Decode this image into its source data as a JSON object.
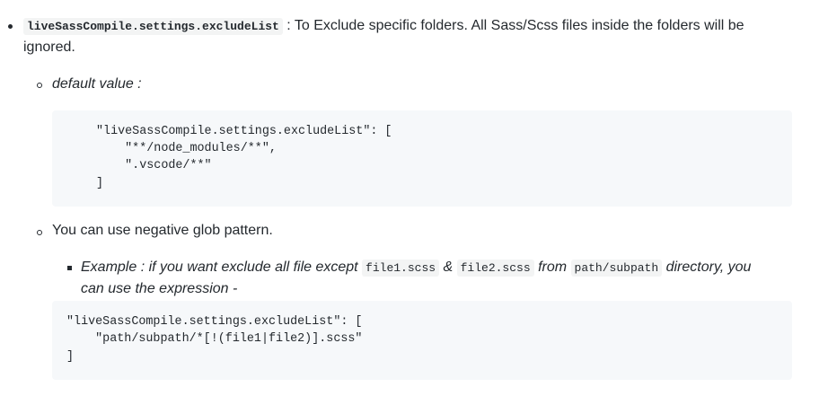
{
  "item1": {
    "setting_key": "liveSassCompile.settings.excludeList",
    "separator": " : ",
    "description_line1": "To Exclude specific folders. All Sass/Scss files inside the folders will be",
    "description_line2": "ignored."
  },
  "default_value": {
    "label": "default value :",
    "code_lines": [
      "\"liveSassCompile.settings.excludeList\": [",
      "    \"**/node_modules/**\",",
      "    \".vscode/**\"",
      "]"
    ]
  },
  "negative_glob": {
    "text": "You can use negative glob pattern."
  },
  "example": {
    "prefix": "Example : if you want exclude all file except ",
    "file1": "file1.scss",
    "amp": " & ",
    "file2": "file2.scss",
    "from": " from ",
    "path": "path/subpath",
    "suffix": " directory, you",
    "line2": "can use the expression -",
    "code_lines": [
      "\"liveSassCompile.settings.excludeList\": [",
      "    \"path/subpath/*[!(file1|file2)].scss\"",
      "]"
    ]
  }
}
